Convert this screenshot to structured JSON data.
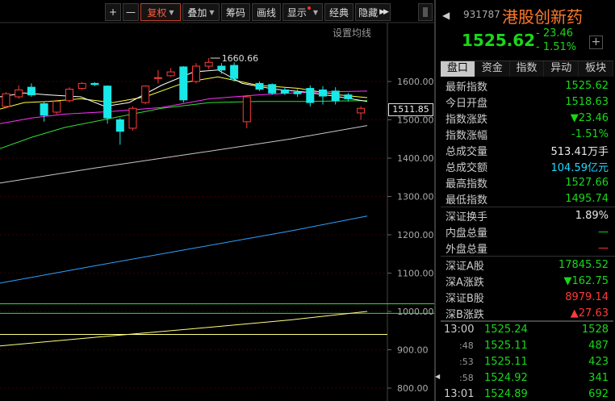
{
  "toolbar": {
    "plus": "+",
    "minus": "—",
    "fuquan": "复权",
    "diejia": "叠加",
    "chouma": "筹码",
    "huaxian": "画线",
    "xianshi": "显示",
    "jingdian": "经典",
    "yincang": "隐藏"
  },
  "ma_settings": "设置均线",
  "chart_data": {
    "type": "candlestick",
    "y_ticks": [
      "1600.00",
      "1500.00",
      "1400.00",
      "1300.00",
      "1200.00",
      "1100.00",
      "1000.00",
      "900.00",
      "800.00"
    ],
    "ylim": [
      780,
      1680
    ],
    "current_price_label": "1511.85",
    "high_annotation": "1660.66",
    "candles": [
      {
        "o": 1535,
        "c": 1568,
        "h": 1572,
        "l": 1530
      },
      {
        "o": 1560,
        "c": 1578,
        "h": 1590,
        "l": 1555
      },
      {
        "o": 1585,
        "c": 1565,
        "h": 1595,
        "l": 1560
      },
      {
        "o": 1542,
        "c": 1512,
        "h": 1548,
        "l": 1495
      },
      {
        "o": 1520,
        "c": 1548,
        "h": 1552,
        "l": 1515
      },
      {
        "o": 1550,
        "c": 1580,
        "h": 1585,
        "l": 1545
      },
      {
        "o": 1582,
        "c": 1595,
        "h": 1598,
        "l": 1578
      },
      {
        "o": 1595,
        "c": 1592,
        "h": 1598,
        "l": 1588
      },
      {
        "o": 1588,
        "c": 1505,
        "h": 1590,
        "l": 1490
      },
      {
        "o": 1500,
        "c": 1470,
        "h": 1505,
        "l": 1435
      },
      {
        "o": 1478,
        "c": 1530,
        "h": 1535,
        "l": 1472
      },
      {
        "o": 1545,
        "c": 1588,
        "h": 1590,
        "l": 1540
      },
      {
        "o": 1610,
        "c": 1610,
        "h": 1630,
        "l": 1595
      },
      {
        "o": 1615,
        "c": 1625,
        "h": 1635,
        "l": 1612
      },
      {
        "o": 1638,
        "c": 1552,
        "h": 1640,
        "l": 1545
      },
      {
        "o": 1600,
        "c": 1640,
        "h": 1648,
        "l": 1595
      },
      {
        "o": 1640,
        "c": 1650,
        "h": 1661,
        "l": 1632
      },
      {
        "o": 1640,
        "c": 1630,
        "h": 1648,
        "l": 1620
      },
      {
        "o": 1642,
        "c": 1608,
        "h": 1650,
        "l": 1600
      },
      {
        "o": 1495,
        "c": 1560,
        "h": 1565,
        "l": 1478
      },
      {
        "o": 1595,
        "c": 1580,
        "h": 1600,
        "l": 1575
      },
      {
        "o": 1592,
        "c": 1570,
        "h": 1595,
        "l": 1565
      },
      {
        "o": 1578,
        "c": 1570,
        "h": 1585,
        "l": 1565
      },
      {
        "o": 1572,
        "c": 1568,
        "h": 1580,
        "l": 1560
      },
      {
        "o": 1582,
        "c": 1545,
        "h": 1590,
        "l": 1535
      },
      {
        "o": 1578,
        "c": 1562,
        "h": 1588,
        "l": 1540
      },
      {
        "o": 1575,
        "c": 1550,
        "h": 1585,
        "l": 1540
      },
      {
        "o": 1565,
        "c": 1555,
        "h": 1570,
        "l": 1548
      },
      {
        "o": 1518,
        "c": 1530,
        "h": 1535,
        "l": 1500
      }
    ],
    "colors": {
      "up": "#ff3a3a",
      "down": "#18e8e8",
      "ma5": "#ffffff",
      "ma10": "#ffff40",
      "ma20": "#ff30ff",
      "ma30": "#30e030",
      "ma60": "#c8c8c8",
      "ma120": "#30a0ff",
      "ma250": "#ffff80",
      "hline": "#30e030"
    }
  },
  "panel": {
    "code": "931787",
    "name": "港股创新药",
    "price": "1525.62",
    "change": "- 23.46",
    "change_pct": "- 1.51%",
    "add": "+",
    "tabs": [
      "盘口",
      "资金",
      "指数",
      "异动",
      "板块"
    ],
    "rows": [
      {
        "label": "最新指数",
        "value": "1525.62",
        "color": "green"
      },
      {
        "label": "今日开盘",
        "value": "1518.63",
        "color": "green"
      },
      {
        "label": "指数涨跌",
        "value": "▼23.46",
        "color": "green"
      },
      {
        "label": "指数涨幅",
        "value": "-1.51%",
        "color": "green"
      },
      {
        "label": "总成交量",
        "value": "513.41万手",
        "color": "white"
      },
      {
        "label": "总成交额",
        "value": "104.59亿元",
        "color": "cyan"
      },
      {
        "label": "最高指数",
        "value": "1527.66",
        "color": "green"
      },
      {
        "label": "最低指数",
        "value": "1495.74",
        "color": "green"
      }
    ],
    "rows2": [
      {
        "label": "深证换手",
        "value": "1.89%",
        "color": "white"
      },
      {
        "label": "内盘总量",
        "value": "—",
        "color": "green"
      },
      {
        "label": "外盘总量",
        "value": "—",
        "color": "red"
      }
    ],
    "rows3": [
      {
        "label": "深证A股",
        "value": "17845.52",
        "color": "green"
      },
      {
        "label": "深A涨跌",
        "value": "▼162.75",
        "color": "green"
      },
      {
        "label": "深证B股",
        "value": "8979.14",
        "color": "red"
      },
      {
        "label": "深B涨跌",
        "value": "▲27.63",
        "color": "red"
      }
    ],
    "ticks": [
      {
        "time": "13:00",
        "price": "1525.24",
        "vol": "1528"
      },
      {
        "time": ":48",
        "price": "1525.11",
        "vol": "487"
      },
      {
        "time": ":53",
        "price": "1525.11",
        "vol": "423"
      },
      {
        "time": ":58",
        "price": "1524.92",
        "vol": "341"
      },
      {
        "time": "13:01",
        "price": "1524.89",
        "vol": "692"
      }
    ]
  }
}
